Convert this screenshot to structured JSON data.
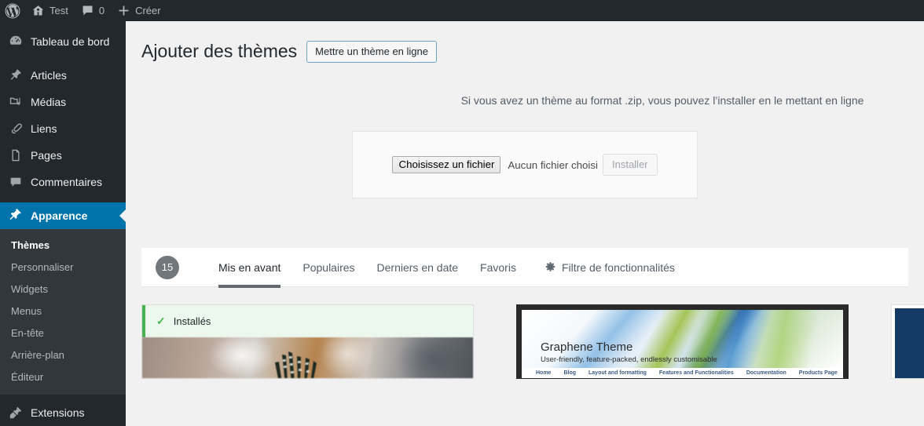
{
  "adminbar": {
    "items": [
      {
        "icon": "wordpress-logo-icon",
        "label": ""
      },
      {
        "icon": "home-icon",
        "label": "Test"
      },
      {
        "icon": "comment-icon",
        "label": "0"
      },
      {
        "icon": "plus-icon",
        "label": "Créer"
      }
    ],
    "site_name": "Test",
    "comment_count": "0",
    "new_label": "Créer"
  },
  "sidebar": {
    "items": [
      {
        "label": "Tableau de bord",
        "icon": "dashboard-icon",
        "current": false
      },
      {
        "label": "Articles",
        "icon": "pin-icon",
        "current": false
      },
      {
        "label": "Médias",
        "icon": "media-icon",
        "current": false
      },
      {
        "label": "Liens",
        "icon": "link-icon",
        "current": false
      },
      {
        "label": "Pages",
        "icon": "page-icon",
        "current": false
      },
      {
        "label": "Commentaires",
        "icon": "comment-icon",
        "current": false
      },
      {
        "label": "Apparence",
        "icon": "appearance-icon",
        "current": true
      },
      {
        "label": "Extensions",
        "icon": "plugins-icon",
        "current": false
      }
    ],
    "submenu": [
      {
        "label": "Thèmes",
        "current": true
      },
      {
        "label": "Personnaliser",
        "current": false
      },
      {
        "label": "Widgets",
        "current": false
      },
      {
        "label": "Menus",
        "current": false
      },
      {
        "label": "En-tête",
        "current": false
      },
      {
        "label": "Arrière-plan",
        "current": false
      },
      {
        "label": "Éditeur",
        "current": false
      }
    ]
  },
  "page": {
    "title": "Ajouter des thèmes",
    "upload_toggle_label": "Mettre un thème en ligne",
    "upload_instructions": "Si vous avez un thème au format .zip, vous pouvez l’installer en le mettant en ligne",
    "choose_file_label": "Choisissez un fichier",
    "no_file_label": "Aucun fichier choisi",
    "install_label": "Installer"
  },
  "filter_bar": {
    "count": "15",
    "tabs": [
      {
        "label": "Mis en avant",
        "current": true
      },
      {
        "label": "Populaires",
        "current": false
      },
      {
        "label": "Derniers en date",
        "current": false
      },
      {
        "label": "Favoris",
        "current": false
      }
    ],
    "feature_filter_label": "Filtre de fonctionnalités",
    "feature_filter_icon": "gear-icon"
  },
  "themes": [
    {
      "notice": "Installés",
      "notice_icon": "check-icon",
      "screenshot_type": "photo"
    },
    {
      "title": "Graphene Theme",
      "tagline": "User-friendly, feature-packed, endlessly customisable",
      "nav": [
        "Home",
        "Blog",
        "Layout and formatting",
        "Features and Functionalities",
        "Documentation",
        "Products Page"
      ],
      "screenshot_type": "banner"
    },
    {
      "screenshot_type": "solid",
      "color": "#123a64"
    }
  ],
  "colors": {
    "admin_blue": "#0073aa",
    "sidebar_bg": "#23282d",
    "submenu_bg": "#32373c",
    "content_bg": "#f1f1f1",
    "notice_green": "#46b450",
    "badge_gray": "#72777c"
  }
}
